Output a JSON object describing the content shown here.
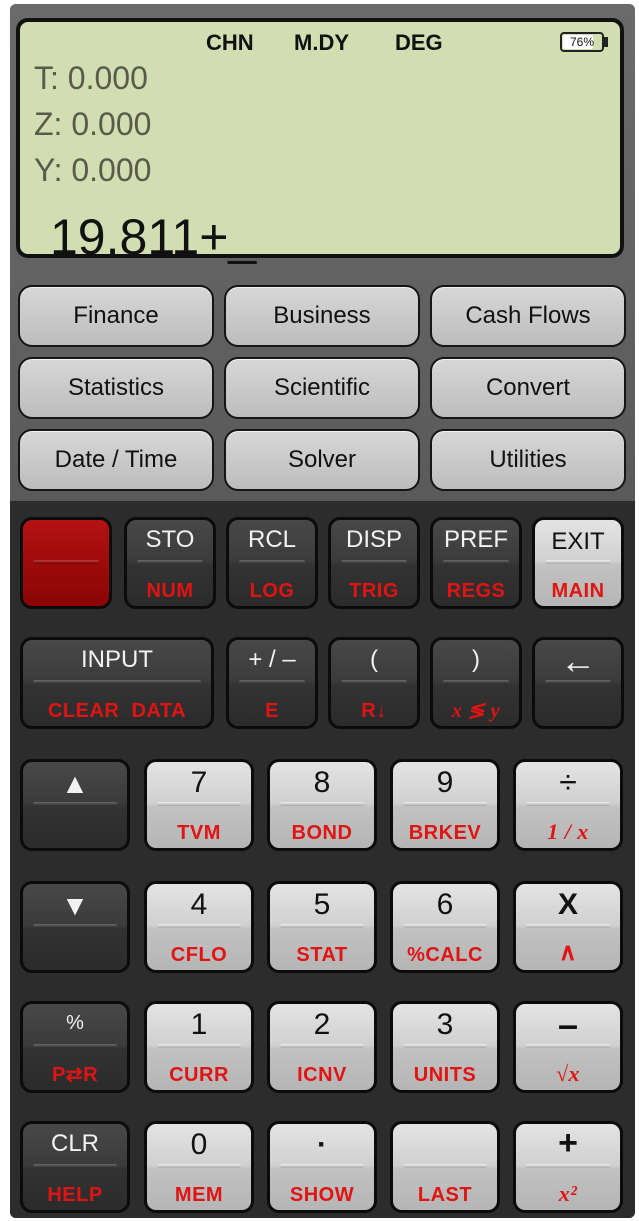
{
  "display": {
    "annunciators": [
      "CHN",
      "M.DY",
      "DEG"
    ],
    "battery_percent": "76%",
    "battery_level": 0.76,
    "stack": {
      "t": "T: 0.000",
      "z": "Z: 0.000",
      "y": "Y: 0.000"
    },
    "entry": "19.811+_"
  },
  "menu": [
    "Finance",
    "Business",
    "Cash Flows",
    "Statistics",
    "Scientific",
    "Convert",
    "Date / Time",
    "Solver",
    "Utilities"
  ],
  "keys": {
    "row1": [
      {
        "main": "",
        "shift": ""
      },
      {
        "main": "STO",
        "shift": "NUM"
      },
      {
        "main": "RCL",
        "shift": "LOG"
      },
      {
        "main": "DISP",
        "shift": "TRIG"
      },
      {
        "main": "PREF",
        "shift": "REGS"
      },
      {
        "main": "EXIT",
        "shift": "MAIN"
      }
    ],
    "row2": [
      {
        "main": "INPUT",
        "shift": "CLEAR  DATA"
      },
      {
        "main": "+ / –",
        "shift": "E"
      },
      {
        "main": "(",
        "shift": "R↓"
      },
      {
        "main": ")",
        "shift": "x ≶ y"
      },
      {
        "main": "←",
        "shift": ""
      }
    ],
    "row3": [
      {
        "main": "▲",
        "shift": ""
      },
      {
        "main": "7",
        "shift": "TVM"
      },
      {
        "main": "8",
        "shift": "BOND"
      },
      {
        "main": "9",
        "shift": "BRKEV"
      },
      {
        "main": "÷",
        "shift": "1 / x"
      }
    ],
    "row4": [
      {
        "main": "▼",
        "shift": ""
      },
      {
        "main": "4",
        "shift": "CFLO"
      },
      {
        "main": "5",
        "shift": "STAT"
      },
      {
        "main": "6",
        "shift": "%CALC"
      },
      {
        "main": "X",
        "shift": "∧"
      }
    ],
    "row5": [
      {
        "main": "%",
        "shift": "P⇄R"
      },
      {
        "main": "1",
        "shift": "CURR"
      },
      {
        "main": "2",
        "shift": "ICNV"
      },
      {
        "main": "3",
        "shift": "UNITS"
      },
      {
        "main": "–",
        "shift": "√x"
      }
    ],
    "row6": [
      {
        "main": "CLR",
        "shift": "HELP"
      },
      {
        "main": "0",
        "shift": "MEM"
      },
      {
        "main": "·",
        "shift": "SHOW"
      },
      {
        "main": "",
        "shift": "LAST"
      },
      {
        "main": "+",
        "shift": "x²"
      }
    ]
  },
  "colors": {
    "lcd": "#d2ddb1",
    "shift_text": "#e11313",
    "shift_key": "#a50c0c"
  }
}
